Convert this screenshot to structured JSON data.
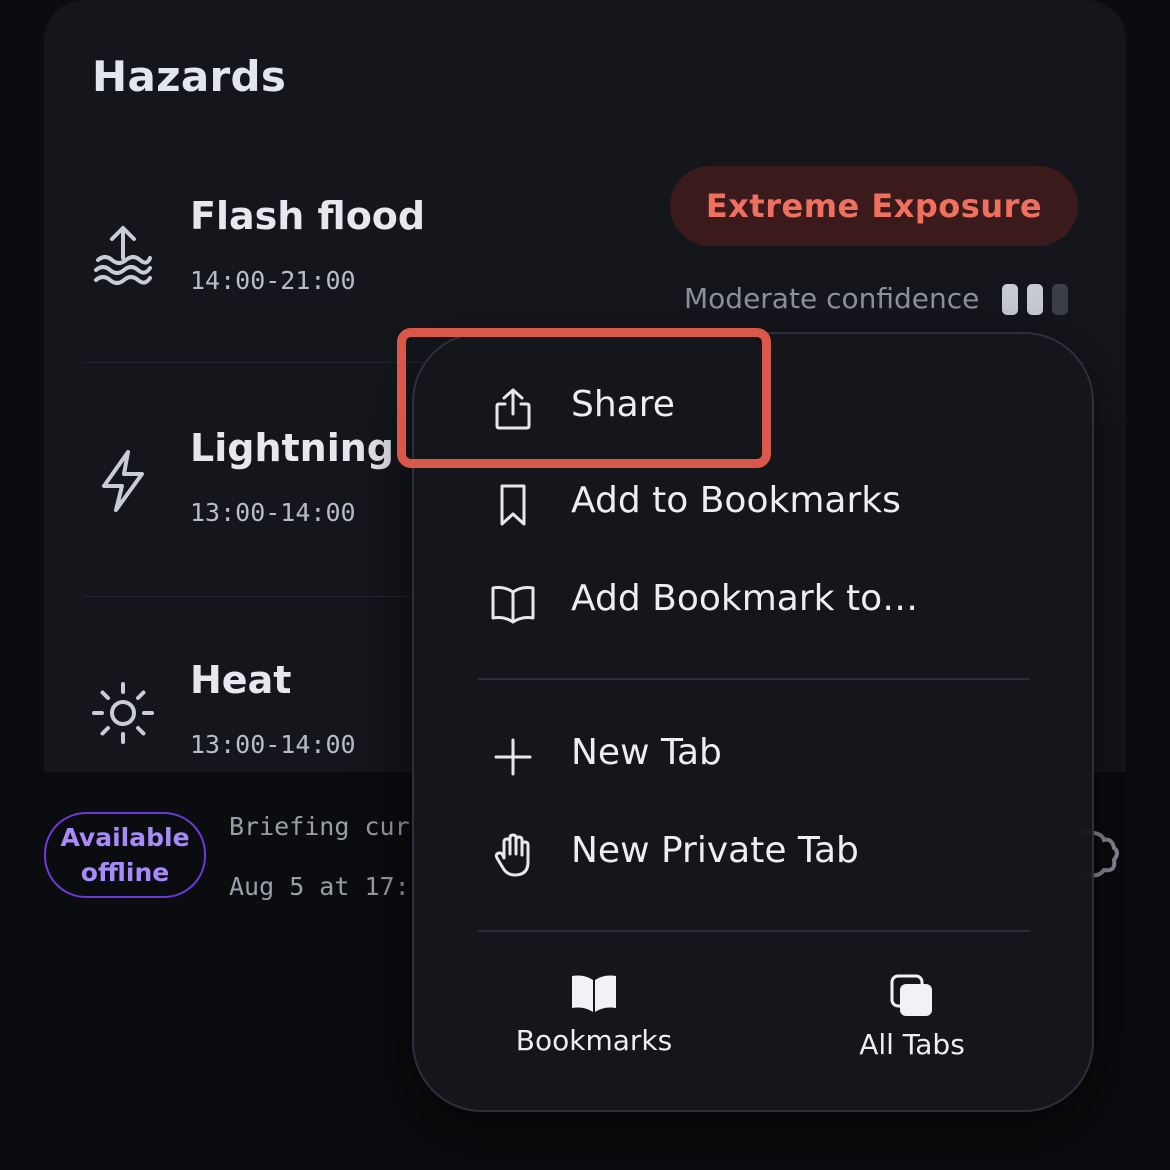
{
  "card": {
    "title": "Hazards",
    "hazards": [
      {
        "name": "Flash flood",
        "time": "14:00-21:00",
        "icon": "flood-icon"
      },
      {
        "name": "Lightning",
        "time": "13:00-14:00",
        "icon": "lightning-icon"
      },
      {
        "name": "Heat",
        "time": "13:00-14:00",
        "icon": "sun-icon"
      }
    ],
    "badge": "Extreme Exposure",
    "confidence_label": "Moderate confidence",
    "confidence_level": "2 of 3"
  },
  "footer": {
    "pill_line1": "Available",
    "pill_line2": "offline",
    "briefing_line1": "Briefing cur",
    "briefing_line2": "Aug 5 at 17:"
  },
  "menu": {
    "items": [
      {
        "label": "Share",
        "icon": "share-icon"
      },
      {
        "label": "Add to Bookmarks",
        "icon": "bookmark-icon"
      },
      {
        "label": "Add Bookmark to…",
        "icon": "book-icon"
      },
      {
        "label": "New Tab",
        "icon": "plus-icon"
      },
      {
        "label": "New Private Tab",
        "icon": "hand-icon"
      }
    ],
    "bottom": [
      {
        "label": "Bookmarks",
        "icon": "book-filled-icon"
      },
      {
        "label": "All Tabs",
        "icon": "tabs-icon"
      }
    ]
  },
  "colors": {
    "badge_text": "#f0705f",
    "badge_bg": "#3a1a1b",
    "pill_border": "#6b3ad6",
    "pill_text": "#a78bfa",
    "highlight": "#d9584a"
  }
}
